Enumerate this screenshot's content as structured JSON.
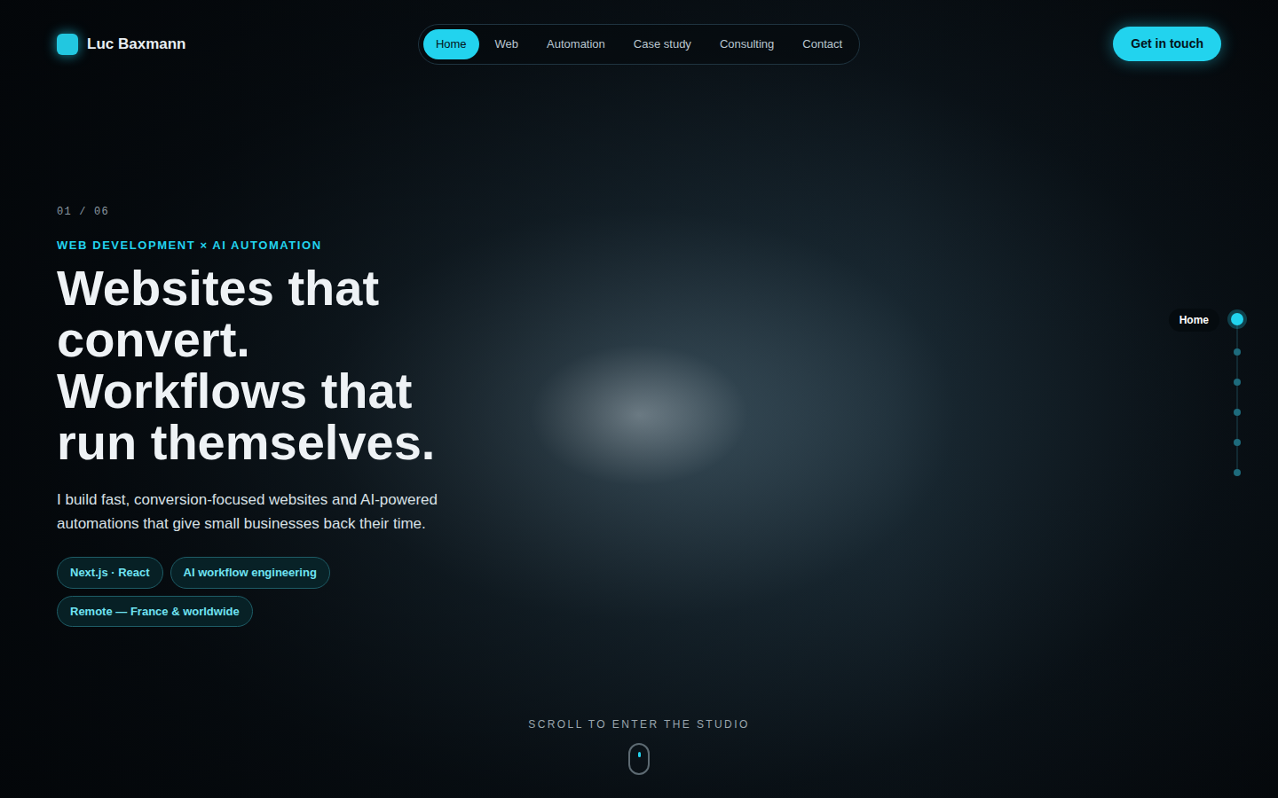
{
  "header": {
    "brand": "Luc Baxmann",
    "nav": [
      {
        "label": "Home",
        "selected": true
      },
      {
        "label": "Web",
        "selected": false
      },
      {
        "label": "Automation",
        "selected": false
      },
      {
        "label": "Case study",
        "selected": false
      },
      {
        "label": "Consulting",
        "selected": false
      },
      {
        "label": "Contact",
        "selected": false
      }
    ],
    "cta": "Get in touch"
  },
  "hero": {
    "counter": "01 / 06",
    "eyebrow": "WEB DEVELOPMENT × AI AUTOMATION",
    "headline": [
      "Websites that",
      "convert.",
      "Workflows that",
      "run themselves."
    ],
    "description": "I build fast, conversion-focused websites and AI-powered automations that give small businesses back their time.",
    "tags": [
      "Next.js · React",
      "AI workflow engineering",
      "Remote — France & worldwide"
    ]
  },
  "side_nav": {
    "label": "Home",
    "dots": [
      {
        "selected": true
      },
      {
        "selected": false
      },
      {
        "selected": false
      },
      {
        "selected": false
      },
      {
        "selected": false
      },
      {
        "selected": false
      }
    ]
  },
  "scroll_hint": "SCROLL TO ENTER THE STUDIO"
}
